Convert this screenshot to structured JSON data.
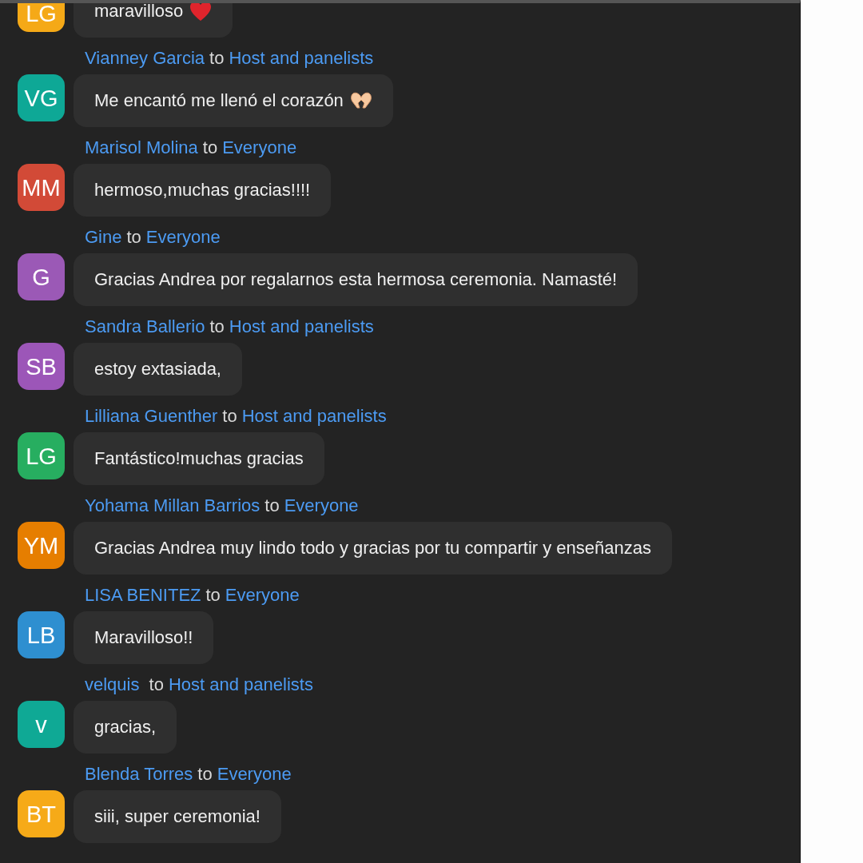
{
  "messages": [
    {
      "initials": "LG",
      "color": "#f5a917",
      "text": "maravilloso",
      "kind": "heart"
    },
    {
      "sender": "Vianney Garcia",
      "to": "to",
      "recipient": "Host and panelists",
      "initials": "VG",
      "color": "#0ea896",
      "text": "Me encantó me llenó el corazón",
      "kind": "heart-hands"
    },
    {
      "sender": "Marisol Molina",
      "to": "to",
      "recipient": "Everyone",
      "initials": "MM",
      "color": "#d24a37",
      "text": "hermoso,muchas gracias!!!!"
    },
    {
      "sender": "Gine",
      "to": "to",
      "recipient": "Everyone",
      "initials": "G",
      "color": "#9b59b6",
      "text": "Gracias Andrea por regalarnos esta hermosa ceremonia. Namasté!"
    },
    {
      "sender": "Sandra Ballerio",
      "to": "to",
      "recipient": "Host and panelists",
      "initials": "SB",
      "color": "#9c56b8",
      "text": "estoy extasiada,"
    },
    {
      "sender": "Lilliana Guenther",
      "to": "to",
      "recipient": "Host and panelists",
      "initials": "LG",
      "color": "#27ae60",
      "text": "Fantástico!muchas gracias"
    },
    {
      "sender": "Yohama Millan Barrios",
      "to": "to",
      "recipient": "Everyone",
      "initials": "YM",
      "color": "#e67e00",
      "text": "Gracias Andrea muy lindo todo y gracias por tu compartir y enseñanzas"
    },
    {
      "sender": "LISA BENITEZ",
      "to": "to",
      "recipient": "Everyone",
      "initials": "LB",
      "color": "#2e8fd0",
      "text": "Maravilloso!!"
    },
    {
      "sender": "velquis ",
      "to": "to",
      "recipient": "Host and panelists",
      "initials": "v",
      "color": "#0fa995",
      "text": "gracias,"
    },
    {
      "sender": "Blenda Torres",
      "to": "to",
      "recipient": "Everyone",
      "initials": "BT",
      "color": "#f6aa18",
      "text": "siii, super ceremonia!"
    }
  ]
}
